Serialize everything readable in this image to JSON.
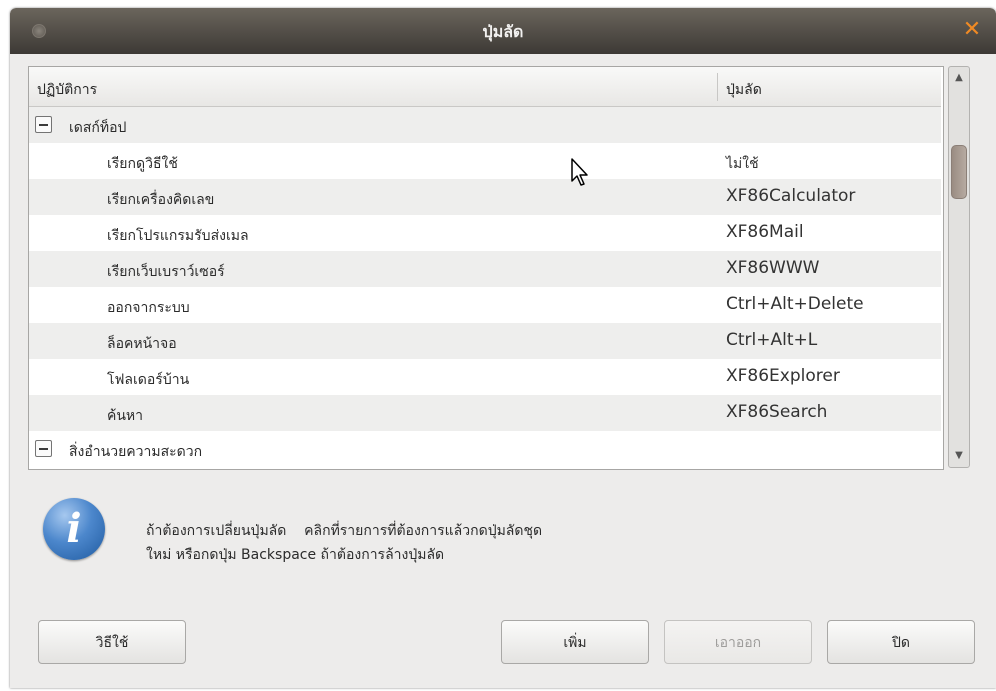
{
  "window": {
    "title": "ปุ่มลัด",
    "close_glyph": "✕"
  },
  "tree": {
    "headers": {
      "action": "ปฏิบัติการ",
      "shortcut": "ปุ่มลัด"
    },
    "rows": [
      {
        "action": "เดสก์ท็อป",
        "shortcut": ""
      },
      {
        "action": "เรียกดูวิธีใช้",
        "shortcut": "ไม่ใช้"
      },
      {
        "action": "เรียกเครื่องคิดเลข",
        "shortcut": "XF86Calculator"
      },
      {
        "action": "เรียกโปรแกรมรับส่งเมล",
        "shortcut": "XF86Mail"
      },
      {
        "action": "เรียกเว็บเบราว์เซอร์",
        "shortcut": "XF86WWW"
      },
      {
        "action": "ออกจากระบบ",
        "shortcut": "Ctrl+Alt+Delete"
      },
      {
        "action": "ล็อคหน้าจอ",
        "shortcut": "Ctrl+Alt+L"
      },
      {
        "action": "โฟลเดอร์บ้าน",
        "shortcut": "XF86Explorer"
      },
      {
        "action": "ค้นหา",
        "shortcut": "XF86Search"
      },
      {
        "action": "สิ่งอำนวยความสะดวก",
        "shortcut": ""
      }
    ]
  },
  "scrollbar": {
    "up_glyph": "▲",
    "down_glyph": "▼"
  },
  "info": {
    "icon_glyph": "i",
    "line1": "ถ้าต้องการเปลี่ยนปุ่มลัด    คลิกที่รายการที่ต้องการแล้วกดปุ่มลัดชุด",
    "line2": "ใหม่ หรือกดปุ่ม Backspace ถ้าต้องการล้างปุ่มลัด"
  },
  "buttons": {
    "help": "วิธีใช้",
    "add": "เพิ่ม",
    "remove": "เอาออก",
    "close": "ปิด"
  },
  "colors": {
    "titlebar": "#3d3935",
    "close_accent": "#f08a24",
    "info_icon": "#4c87cc"
  }
}
